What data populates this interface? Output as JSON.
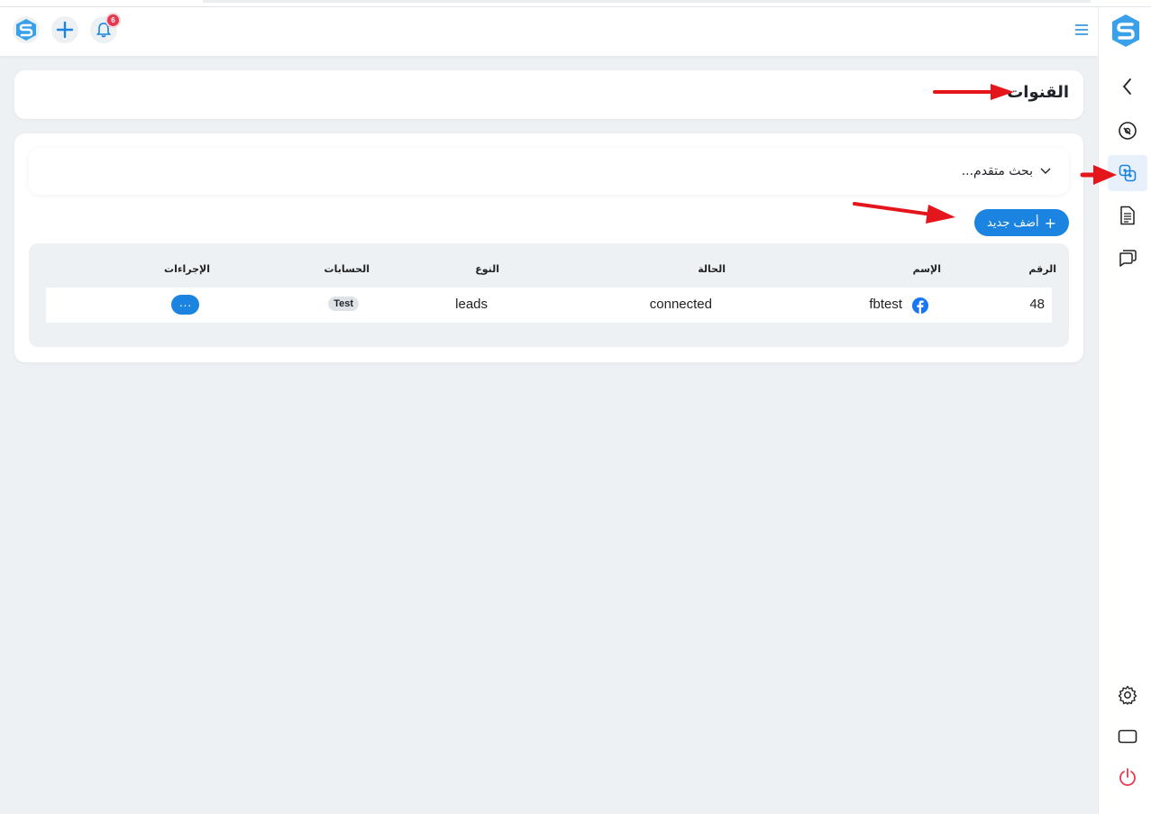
{
  "topbar": {
    "notifications_count": "6",
    "logo_icon": "logo-icon",
    "add_icon": "plus-icon",
    "bell_icon": "bell-icon",
    "menu_icon": "menu-icon"
  },
  "page": {
    "title": "القنوات"
  },
  "search": {
    "toggle_label": "بحث متقدم..."
  },
  "actions": {
    "add_label": "أضف جديد",
    "add_symbol": "+"
  },
  "table": {
    "headers": {
      "id": "الرقم",
      "name": "الإسم",
      "status": "الحالة",
      "type": "النوع",
      "accounts": "الحسابات",
      "actions": "الإجراءات"
    },
    "rows": [
      {
        "id": "48",
        "name": "fbtest",
        "status": "connected",
        "type": "leads",
        "account_tag": "Test",
        "actions_label": "···"
      }
    ]
  },
  "sidebar": {
    "items": [
      "collapse-icon",
      "dashboard-icon",
      "channels-icon",
      "documents-icon",
      "chat-icon",
      "settings-icon",
      "window-icon",
      "power-icon"
    ],
    "active": "channels-icon"
  },
  "colors": {
    "accent": "#1b84e0",
    "badge": "#e53950",
    "power": "#e53950",
    "annotation_arrow": "#e4151b",
    "background": "#eef1f4"
  }
}
